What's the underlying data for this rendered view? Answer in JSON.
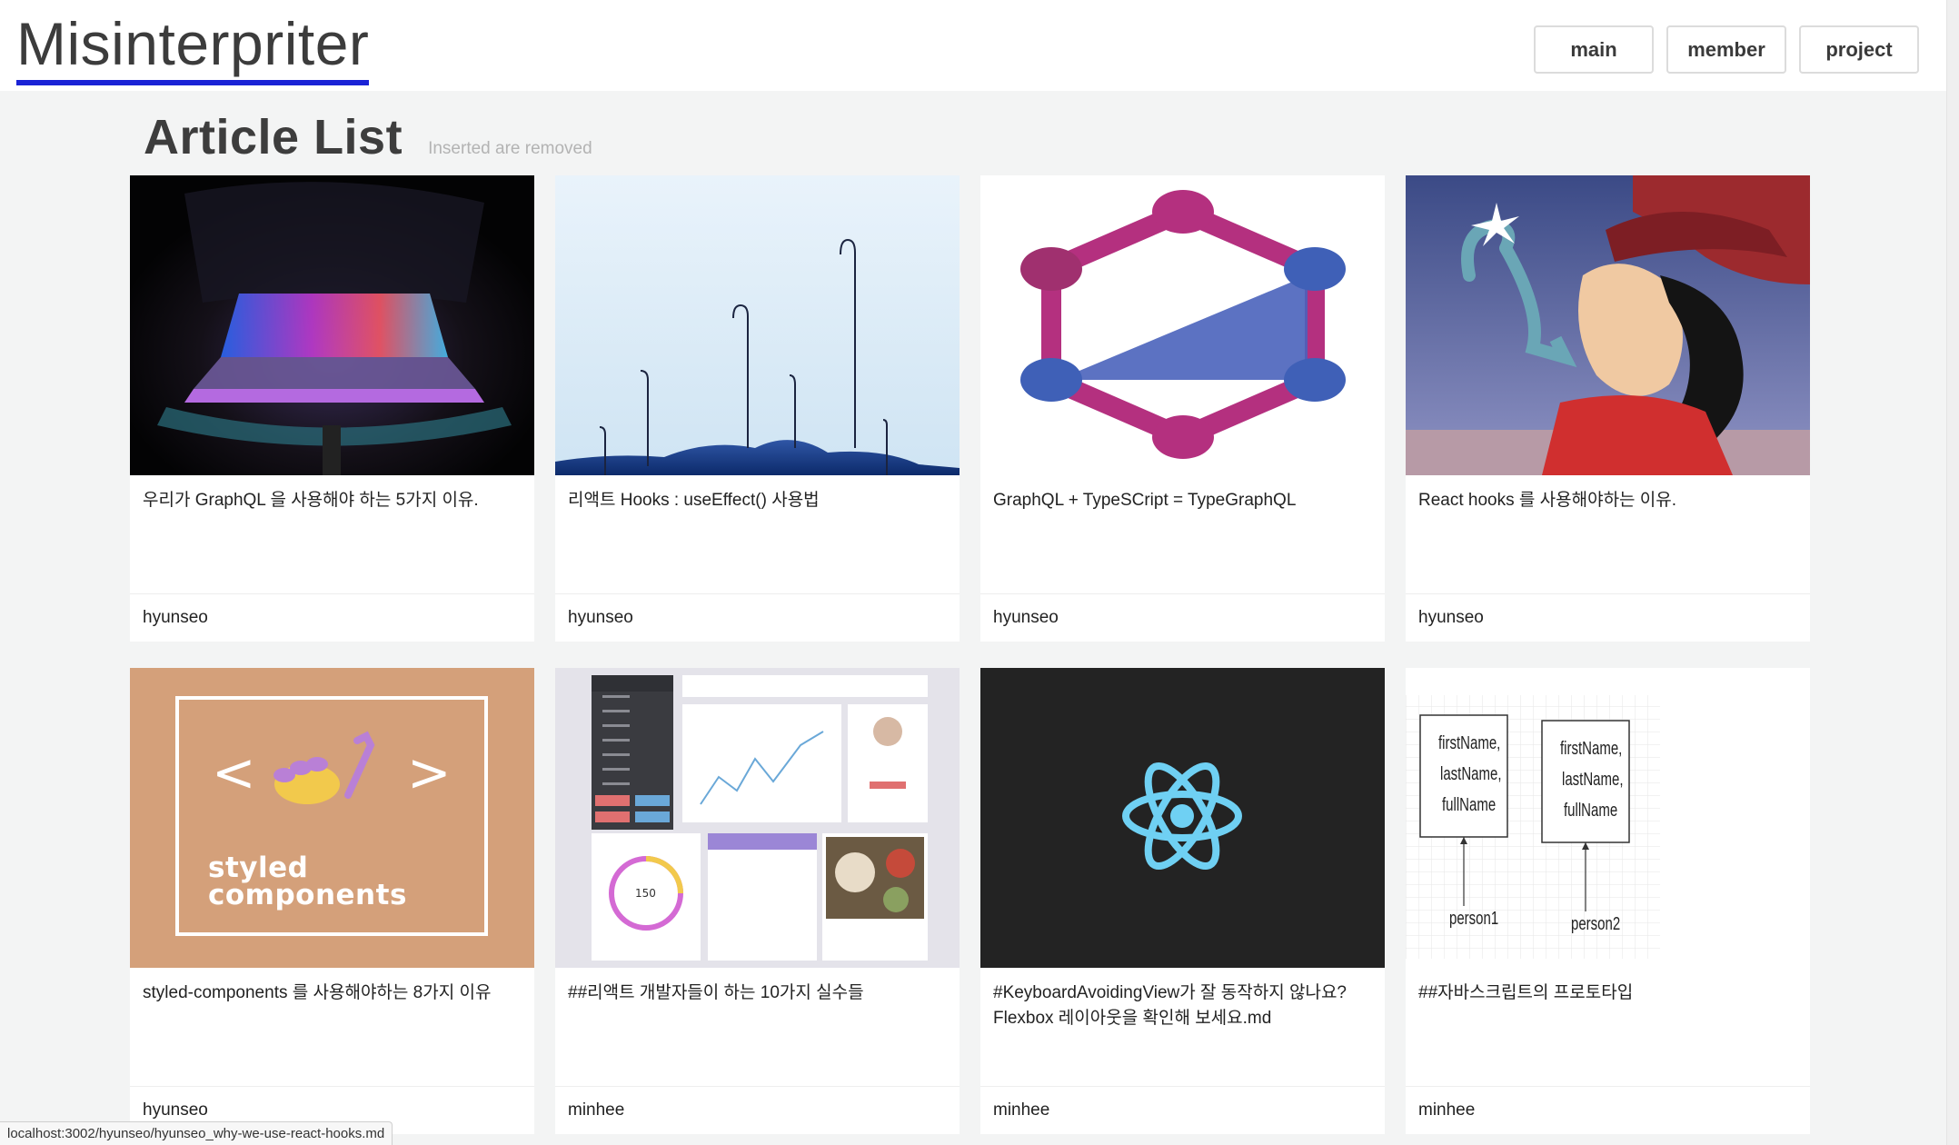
{
  "header": {
    "logo": "Misinterpriter",
    "nav": [
      "main",
      "member",
      "project"
    ]
  },
  "page": {
    "title": "Article List",
    "note": "Inserted are removed"
  },
  "articles": [
    {
      "title": "우리가 GraphQL 을 사용해야 하는 5가지 이유.",
      "author": "hyunseo",
      "thumb": "laptop-image"
    },
    {
      "title": "리액트 Hooks : useEffect() 사용법",
      "author": "hyunseo",
      "thumb": "hooks-image"
    },
    {
      "title": "GraphQL + TypeSCript = TypeGraphQL",
      "author": "hyunseo",
      "thumb": "graphql-logo-image"
    },
    {
      "title": "React hooks 를 사용해야하는 이유.",
      "author": "hyunseo",
      "thumb": "captain-hook-image"
    },
    {
      "title": "styled-components 를 사용해야하는 8가지 이유",
      "author": "hyunseo",
      "thumb": "styled-components-image",
      "thumb_text": "styled\ncomponents"
    },
    {
      "title": "##리액트 개발자들이 하는 10가지 실수들",
      "author": "minhee",
      "thumb": "dashboard-image"
    },
    {
      "title": "#KeyboardAvoidingView가 잘 동작하지 않나요? Flexbox 레이아웃을 확인해 보세요.md",
      "author": "minhee",
      "thumb": "react-logo-image"
    },
    {
      "title": "##자바스크립트의 프로토타입",
      "author": "minhee",
      "thumb": "prototype-diagram-image",
      "diagram_labels": [
        "firstName,",
        "lastName,",
        "fullName",
        "person1",
        "person2"
      ]
    }
  ],
  "status_bar": "localhost:3002/hyunseo/hyunseo_why-we-use-react-hooks.md",
  "colors": {
    "accent_underline": "#1a23d6",
    "page_bg": "#f3f4f4"
  }
}
